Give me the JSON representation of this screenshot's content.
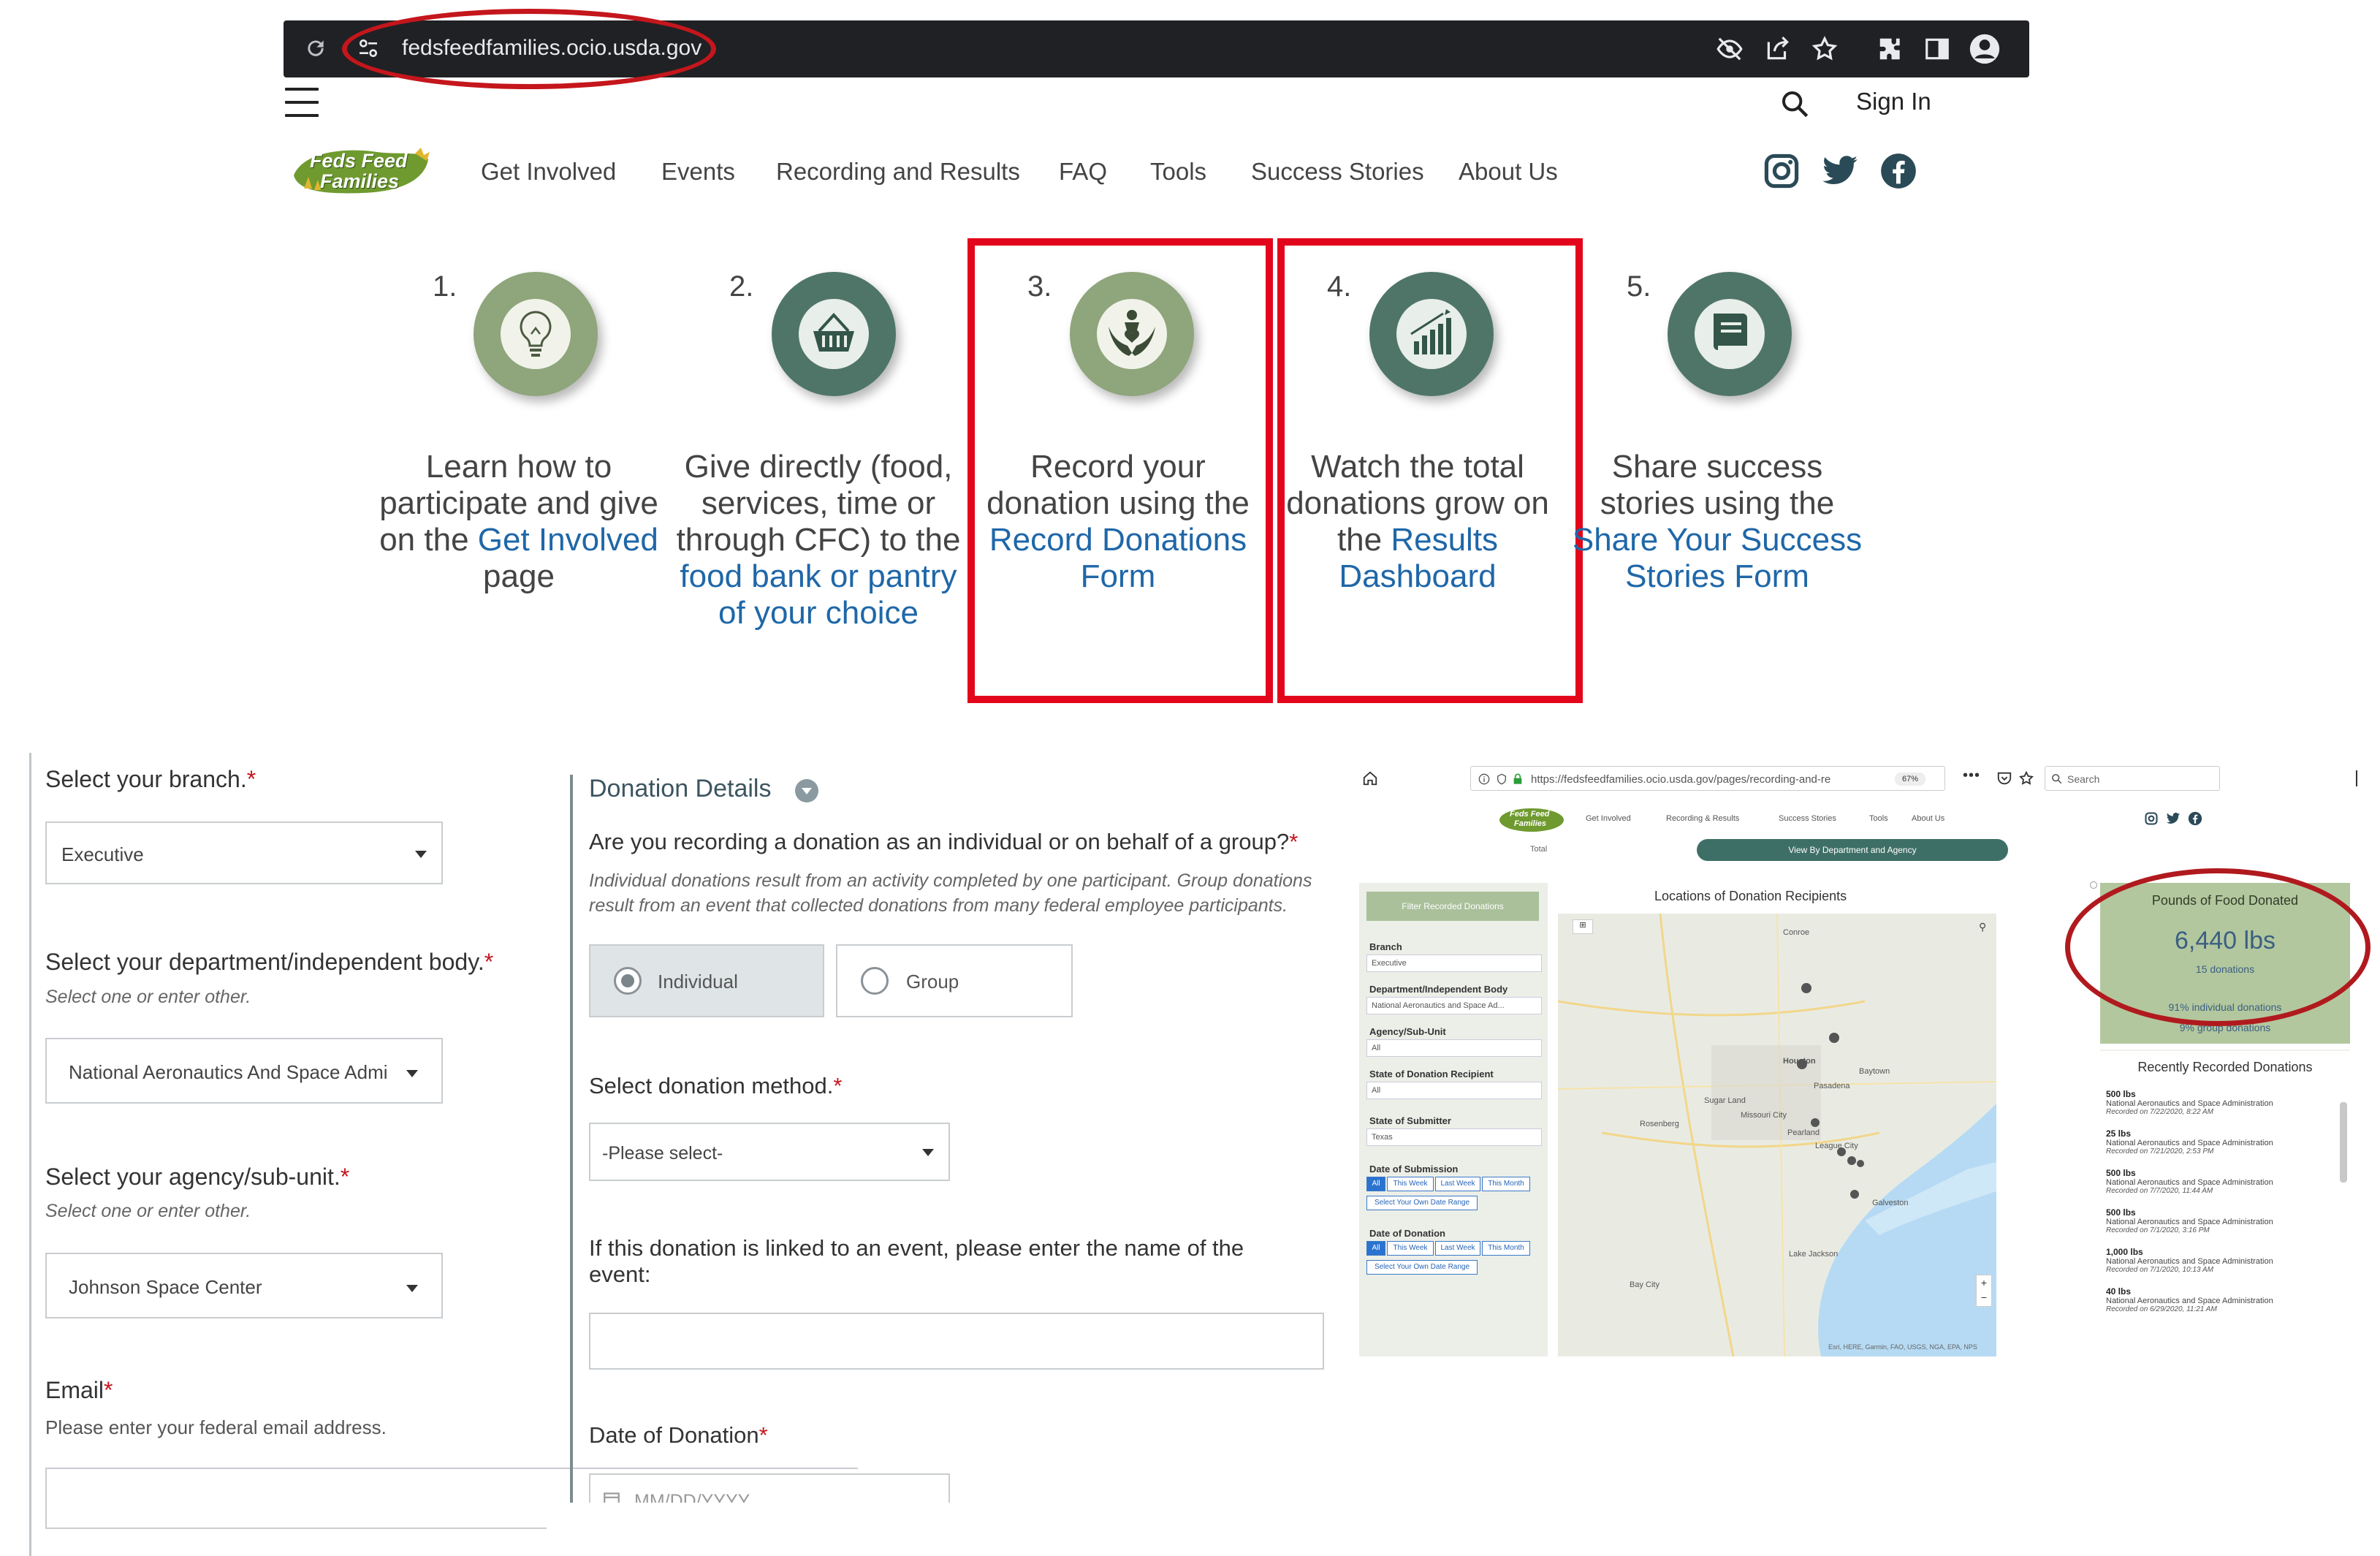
{
  "browser": {
    "url": "fedsfeedfamilies.ocio.usda.gov",
    "icons": [
      "reload-icon",
      "site-settings-icon",
      "eye-off-icon",
      "share-icon",
      "star-icon",
      "extensions-icon",
      "sidepanel-icon",
      "profile-icon"
    ]
  },
  "header": {
    "sign_in": "Sign In",
    "logo_line1": "Feds Feed",
    "logo_line2": "Families",
    "nav": [
      "Get Involved",
      "Events",
      "Recording and Results",
      "FAQ",
      "Tools",
      "Success Stories",
      "About Us"
    ],
    "social": [
      "instagram-icon",
      "twitter-icon",
      "facebook-icon"
    ]
  },
  "steps": [
    {
      "num": "1.",
      "pre": "Learn how to participate and give on the ",
      "link": "Get Involved",
      "post": " page",
      "icon": "lightbulb-icon",
      "color": "#8fa57c"
    },
    {
      "num": "2.",
      "pre": "Give directly (food, services, time or through CFC) to the ",
      "link": "food bank or pantry of your choice",
      "post": "",
      "icon": "basket-icon",
      "color": "#4f7569"
    },
    {
      "num": "3.",
      "pre": "Record your donation using the ",
      "link": "Record Donations Form",
      "post": "",
      "icon": "hands-heart-icon",
      "color": "#8fa57c"
    },
    {
      "num": "4.",
      "pre": "Watch the total donations grow on the ",
      "link": "Results Dashboard",
      "post": "",
      "icon": "bar-chart-icon",
      "color": "#4f7569"
    },
    {
      "num": "5.",
      "pre": "Share success stories using the ",
      "link": "Share Your Success Stories Form",
      "post": "",
      "icon": "book-icon",
      "color": "#4f7569"
    }
  ],
  "form_left": {
    "branch_label": "Select your branch.",
    "branch_value": "Executive",
    "dept_label": "Select your department/independent body.",
    "dept_hint": "Select one or enter other.",
    "dept_value": "National Aeronautics And Space Admi",
    "agency_label": "Select your agency/sub-unit.",
    "agency_hint": "Select one or enter other.",
    "agency_value": "Johnson Space Center",
    "email_label": "Email",
    "email_hint": "Please enter your federal email address.",
    "req": "*"
  },
  "form_mid": {
    "section_title": "Donation Details",
    "q_group": "Are you recording a donation as an individual or on behalf of a group?",
    "q_group_hint": "Individual donations result from an activity completed by one participant. Group donations result from an event that collected donations from many federal employee participants.",
    "opt_individual": "Individual",
    "opt_group": "Group",
    "method_label": "Select donation method.",
    "method_value": "-Please select-",
    "event_label": "If this donation is linked to an event, please enter the name of the event:",
    "date_label": "Date of Donation",
    "date_placeholder": "MM/DD/YYYY"
  },
  "dashboard": {
    "url": "https://fedsfeedfamilies.ocio.usda.gov/pages/recording-and-re",
    "zoom": "67%",
    "search": "Search",
    "logo_line1": "Feds Feed",
    "logo_line2": "Families",
    "nav": [
      "Get Involved",
      "Recording & Results",
      "Success Stories",
      "Tools",
      "About Us"
    ],
    "total_tab": "Total",
    "view_by": "View By Department and Agency",
    "filter_header": "Filter Recorded Donations",
    "filters": [
      {
        "label": "Branch",
        "value": "Executive"
      },
      {
        "label": "Department/Independent Body",
        "value": "National Aeronautics and Space Ad..."
      },
      {
        "label": "Agency/Sub-Unit",
        "value": "All"
      },
      {
        "label": "State of Donation Recipient",
        "value": "All"
      },
      {
        "label": "State of Submitter",
        "value": "Texas"
      }
    ],
    "date_submission": "Date of Submission",
    "date_donation": "Date of Donation",
    "segments": [
      "All",
      "This Week",
      "Last Week",
      "This Month"
    ],
    "custom_range": "Select Your Own Date Range",
    "map_title": "Locations of Donation Recipients",
    "map_labels": [
      "Houston",
      "Pasadena",
      "Baytown",
      "Sugar Land",
      "Missouri City",
      "Pearland",
      "League City",
      "Galveston",
      "Lake Jackson",
      "Bay City",
      "Rosenberg",
      "Conroe"
    ],
    "attribution": "Esri, HERE, Garmin, FAO, USGS, NGA, EPA, NPS",
    "pounds_title": "Pounds of Food Donated",
    "pounds_value": "6,440 lbs",
    "donations_count": "15 donations",
    "individual_pct": "91% individual donations",
    "group_pct": "9% group donations",
    "recent_title": "Recently Recorded Donations",
    "recent": [
      {
        "w": "500 lbs",
        "a": "National Aeronautics and Space Administration",
        "r": "Recorded on 7/22/2020, 8:22 AM"
      },
      {
        "w": "25 lbs",
        "a": "National Aeronautics and Space Administration",
        "r": "Recorded on 7/21/2020, 2:53 PM"
      },
      {
        "w": "500 lbs",
        "a": "National Aeronautics and Space Administration",
        "r": "Recorded on 7/7/2020, 11:44 AM"
      },
      {
        "w": "500 lbs",
        "a": "National Aeronautics and Space Administration",
        "r": "Recorded on 7/1/2020, 3:16 PM"
      },
      {
        "w": "1,000 lbs",
        "a": "National Aeronautics and Space Administration",
        "r": "Recorded on 7/1/2020, 10:13 AM"
      },
      {
        "w": "40 lbs",
        "a": "National Aeronautics and Space Administration",
        "r": "Recorded on 6/29/2020, 11:21 AM"
      }
    ]
  }
}
